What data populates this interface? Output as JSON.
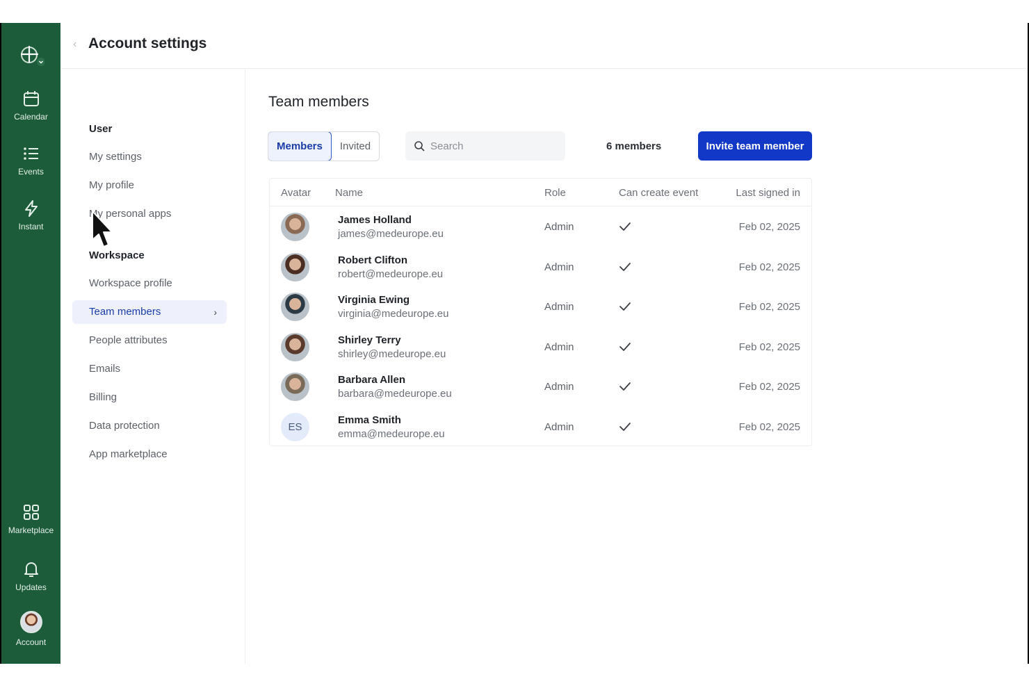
{
  "header": {
    "title": "Account settings"
  },
  "rail": {
    "items": [
      {
        "label": "Calendar",
        "icon": "calendar-icon"
      },
      {
        "label": "Events",
        "icon": "list-icon"
      },
      {
        "label": "Instant",
        "icon": "lightning-icon"
      },
      {
        "label": "Marketplace",
        "icon": "grid-icon"
      },
      {
        "label": "Updates",
        "icon": "bell-icon"
      },
      {
        "label": "Account",
        "icon": "avatar"
      }
    ]
  },
  "nav": {
    "user_section": "User",
    "user_items": [
      "My settings",
      "My profile",
      "My personal apps"
    ],
    "workspace_section": "Workspace",
    "workspace_items": [
      "Workspace profile",
      "Team members",
      "People attributes",
      "Emails",
      "Billing",
      "Data protection",
      "App marketplace"
    ],
    "active": "Team members"
  },
  "main": {
    "title": "Team members",
    "tabs": [
      {
        "label": "Members",
        "active": true
      },
      {
        "label": "Invited",
        "active": false
      }
    ],
    "search_placeholder": "Search",
    "count": "6 members",
    "invite_label": "Invite team member"
  },
  "table": {
    "columns": [
      "Avatar",
      "Name",
      "Role",
      "Can create event",
      "Last signed in"
    ],
    "rows": [
      {
        "name": "James Holland",
        "email": "james@medeurope.eu",
        "role": "Admin",
        "can_create": true,
        "last": "Feb 02, 2025",
        "avatar_color": "#8a6a55"
      },
      {
        "name": "Robert Clifton",
        "email": "robert@medeurope.eu",
        "role": "Admin",
        "can_create": true,
        "last": "Feb 02, 2025",
        "avatar_color": "#4a2e22"
      },
      {
        "name": "Virginia Ewing",
        "email": "virginia@medeurope.eu",
        "role": "Admin",
        "can_create": true,
        "last": "Feb 02, 2025",
        "avatar_color": "#2b3a44"
      },
      {
        "name": "Shirley Terry",
        "email": "shirley@medeurope.eu",
        "role": "Admin",
        "can_create": true,
        "last": "Feb 02, 2025",
        "avatar_color": "#5a3a2c"
      },
      {
        "name": "Barbara Allen",
        "email": "barbara@medeurope.eu",
        "role": "Admin",
        "can_create": true,
        "last": "Feb 02, 2025",
        "avatar_color": "#7a6a5a"
      },
      {
        "name": "Emma Smith",
        "email": "emma@medeurope.eu",
        "role": "Admin",
        "can_create": true,
        "last": "Feb 02, 2025",
        "initials": "ES"
      }
    ]
  },
  "colors": {
    "rail": "#1c5c3b",
    "accent": "#1238c7",
    "active_nav_bg": "#eef1fb"
  }
}
